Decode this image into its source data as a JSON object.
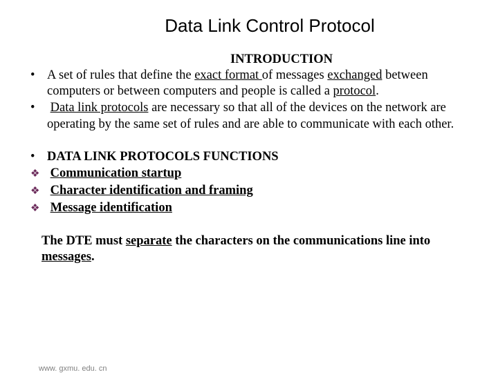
{
  "title": "Data Link Control Protocol",
  "intro_heading": "INTRODUCTION",
  "bullets_intro": {
    "b1": {
      "pre": " A set of rules that define the ",
      "u1": "exact format ",
      "mid1": "of messages ",
      "u2": "exchanged",
      "mid2": " between computers or between computers and people is called a ",
      "u3": "protocol",
      "post": "."
    },
    "b2": {
      "u1": "Data link protocols",
      "rest": " are necessary so that all of the devices on the network are operating by the same set of rules and are able to communicate with each other."
    }
  },
  "functions_heading": "DATA LINK PROTOCOLS FUNCTIONS",
  "functions": {
    "f1": "Communication startup",
    "f2": "Character identification and framing",
    "f3": "Message identification"
  },
  "closing": {
    "pre": "   The DTE must ",
    "u1": "separate",
    "mid": " the characters on the communications line into ",
    "u2": "messages",
    "post": "."
  },
  "footer": "www. gxmu. edu. cn"
}
